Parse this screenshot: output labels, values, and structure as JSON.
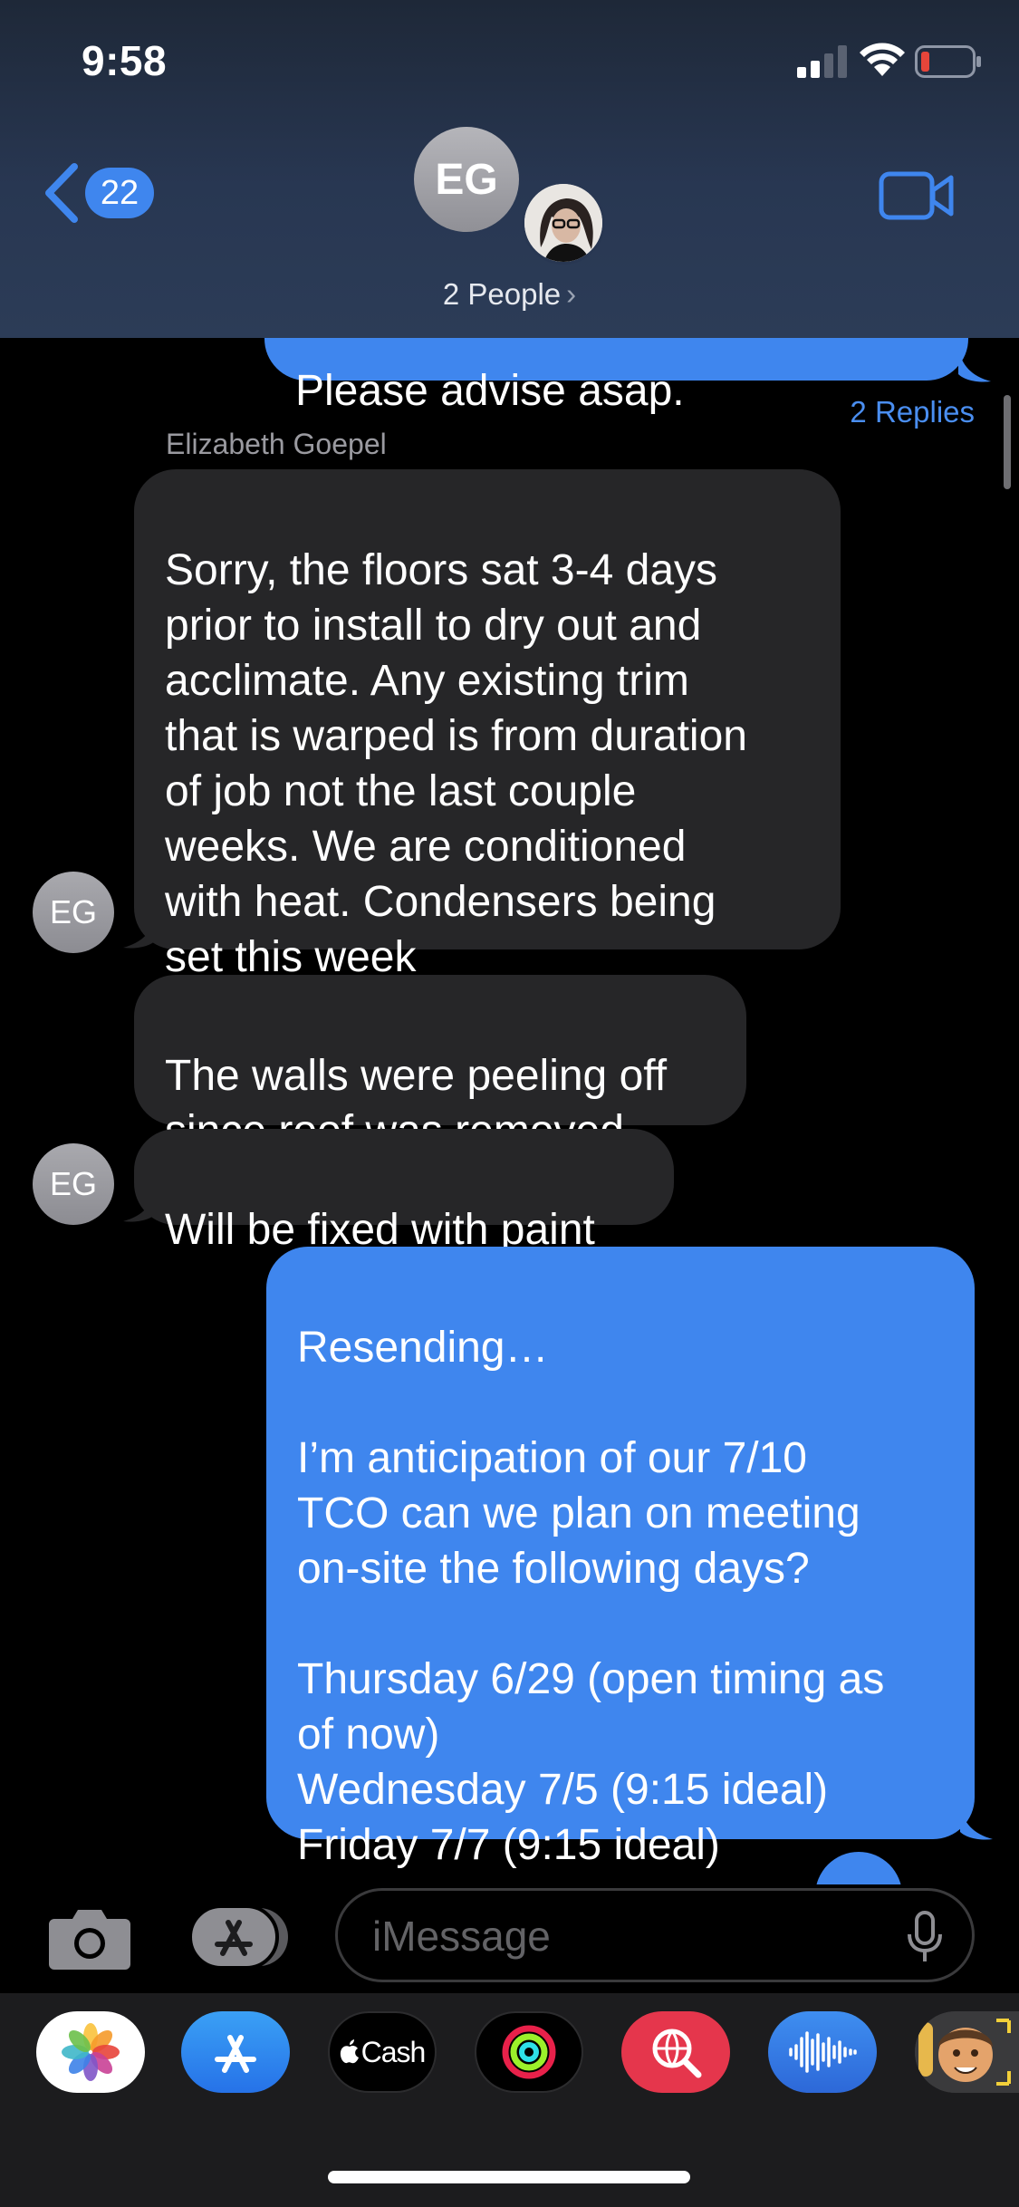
{
  "status_bar": {
    "time": "9:58"
  },
  "header": {
    "back_count": "22",
    "group_initials": "EG",
    "people_label": "2 People",
    "people_chevron": "›"
  },
  "thread": {
    "partial_outgoing": "Please advise asap.",
    "replies_label": "2 Replies",
    "sender_name": "Elizabeth Goepel",
    "messages": [
      {
        "direction": "incoming",
        "text": "Sorry, the floors sat 3-4 days\nprior to install to dry out and\nacclimate. Any existing trim\nthat is warped is from duration\nof job not the last couple\nweeks. We are conditioned\nwith heat. Condensers being\nset this week"
      },
      {
        "direction": "incoming",
        "text": "The walls were peeling off\nsince roof was removed"
      },
      {
        "direction": "incoming",
        "text": "Will be fixed with paint"
      },
      {
        "direction": "outgoing",
        "text": "Resending…\n\nI’m anticipation of our 7/10\nTCO can we plan on meeting\non-site the following days?\n\nThursday 6/29 (open timing as\nof now)\nWednesday 7/5 (9:15 ideal)\nFriday 7/7 (9:15 ideal)"
      }
    ],
    "avatar_initials": "EG"
  },
  "input_bar": {
    "placeholder": "iMessage"
  },
  "app_drawer": {
    "apps": [
      {
        "name": "photos-app",
        "label": ""
      },
      {
        "name": "app-store-app",
        "label": ""
      },
      {
        "name": "apple-cash-app",
        "label": "Cash"
      },
      {
        "name": "fitness-app",
        "label": ""
      },
      {
        "name": "web-search-app",
        "label": ""
      },
      {
        "name": "audio-message-app",
        "label": ""
      },
      {
        "name": "memoji-app",
        "label": ""
      }
    ]
  },
  "colors": {
    "accent": "#3f86ee",
    "incoming_bubble": "#262628",
    "header_top": "#1e2838",
    "header_bottom": "#2c3c57",
    "battery_low": "#e5453a"
  }
}
